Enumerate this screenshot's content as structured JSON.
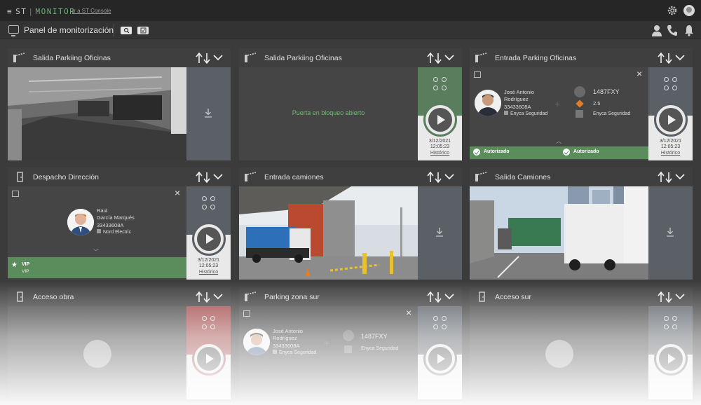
{
  "app": {
    "brand_left": "ST",
    "brand_right": "MONITOR",
    "console_link": "Ir a ST Console"
  },
  "header": {
    "title": "Panel de monitorización"
  },
  "icons": {
    "menu": "hamburger-icon",
    "settings": "gear-icon",
    "user": "user-avatar-icon",
    "search": "search-icon",
    "checklist": "checklist-icon",
    "person": "person-icon",
    "phone": "phone-icon",
    "bell": "bell-icon"
  },
  "panels": [
    {
      "title": "Salida Parkiing Oficinas",
      "side": "grey"
    },
    {
      "title": "Salida Parkiing Oficinas",
      "message": "Puerta en bloqueo abierto",
      "side": "green",
      "date": "3/12/2021",
      "time": "12:05:23",
      "history": "Histórico"
    },
    {
      "title": "Entrada Parking Oficinas",
      "person": {
        "name_line1": "José Antonio",
        "name_line2": "Rodríguez",
        "id": "33433608A",
        "company": "Enyca Seguridad"
      },
      "vehicle": {
        "plate": "1487FXY",
        "weight": "2.5",
        "company": "Enyca Seguridad"
      },
      "status_left": "Autorizado",
      "status_right": "Autorizado",
      "side": "grey",
      "date": "3/12/2021",
      "time": "12:05:23",
      "history": "Histórico"
    },
    {
      "title": "Despacho Dirección",
      "person": {
        "name_line1": "Raul",
        "name_line2": "García Marqués",
        "id": "33433608A",
        "company": "Nord Electric"
      },
      "vip_label": "VIP",
      "vip_sub": "VIP",
      "side": "grey",
      "date": "3/12/2021",
      "time": "12:05:23",
      "history": "Histórico"
    },
    {
      "title": "Entrada camiones",
      "side": "grey"
    },
    {
      "title": "Salida Camiones",
      "side": "grey"
    },
    {
      "title": "Acceso obra",
      "side": "red"
    },
    {
      "title": "Parking zona sur",
      "person": {
        "name_line1": "José Antonio",
        "name_line2": "Rodríguez",
        "id": "33433608A",
        "company": "Enyca Seguridad"
      },
      "vehicle": {
        "plate": "1487FXY",
        "company": "Enyca Seguridad"
      },
      "side": "grey"
    },
    {
      "title": "Acceso sur",
      "side": "grey"
    }
  ],
  "colors": {
    "accent_green": "#5a8c5c",
    "alert_red": "#a24848",
    "message_green": "#6fbf73"
  }
}
